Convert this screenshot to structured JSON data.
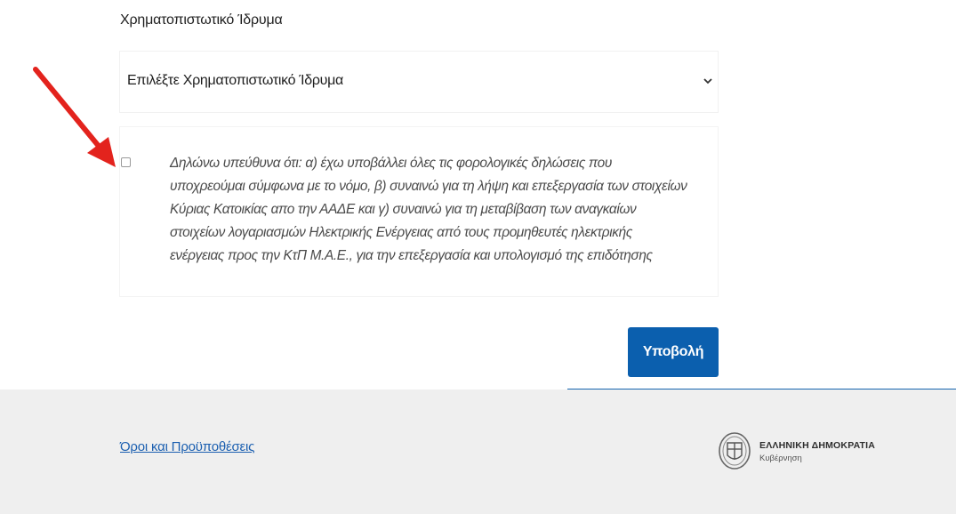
{
  "form": {
    "bank_label": "Χρηματοπιστωτικό Ίδρυμα",
    "bank_select_value": "Επιλέξτε Χρηματοπιστωτικό Ίδρυμα",
    "declaration_lines": [
      "Δηλώνω υπεύθυνα ότι: α) έχω υποβάλλει όλες τις φορολογικές δηλώσεις που",
      "υποχρεούμαι σύμφωνα με το νόμο, β) συναινώ για τη λήψη και επεξεργασία των στοιχείων",
      "Κύριας Κατοικίας απο την ΑΑΔΕ και γ) συναινώ για τη μεταβίβαση των αναγκαίων",
      "στοιχείων λογαριασμών Ηλεκτρικής Ενέργειας από τους προμηθευτές ηλεκτρικής",
      "ενέργειας προς την ΚτΠ Μ.Α.Ε., για την επεξεργασία και υπολογισμό της επιδότησης"
    ],
    "checkbox_checked": false,
    "submit_label": "Υποβολή"
  },
  "footer": {
    "terms_link": "Όροι και Προϋποθέσεις",
    "gov_title": "ΕΛΛΗΝΙΚΗ ΔΗΜΟΚΡΑΤΙΑ",
    "gov_subtitle": "Κυβέρνηση"
  },
  "annotation": {
    "arrow_icon": "red-arrow-pointer",
    "arrow_color": "#e3231d"
  },
  "colors": {
    "primary_button": "#0b5fae",
    "link": "#1b5fb0",
    "footer_bg": "#efefef",
    "footer_line": "#1565b0"
  }
}
